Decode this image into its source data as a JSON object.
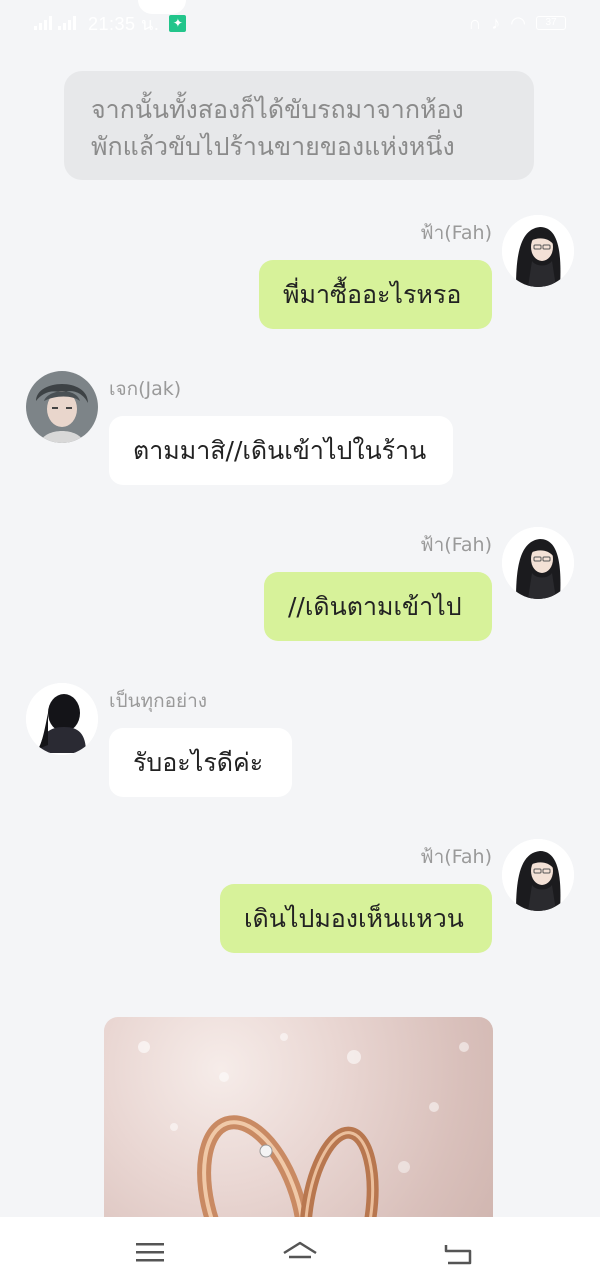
{
  "status_bar": {
    "time": "21:35 น.",
    "network_1": "4G",
    "network_2": "4G",
    "battery": "37",
    "icons": [
      "signal-icon",
      "signal-icon",
      "running-app-icon",
      "nfc-icon",
      "mute-icon",
      "wifi-icon",
      "battery-icon"
    ]
  },
  "narration": {
    "line1": "จากนั้นทั้งสองก็ได้ขับรถมาจากห้อง",
    "line2": "พักแล้วขับไปร้านขายของแห่งหนึ่ง"
  },
  "messages": [
    {
      "sender": "ฟ้า(Fah)",
      "text": "พี่มาซื้ออะไรหรอ",
      "side": "right"
    },
    {
      "sender": "เจก(Jak)",
      "text": "ตามมาสิ//เดินเข้าไปในร้าน",
      "side": "left"
    },
    {
      "sender": "ฟ้า(Fah)",
      "text": "//เดินตามเข้าไป",
      "side": "right"
    },
    {
      "sender": "เป็นทุกอย่าง",
      "text": "รับอะไรดีค่ะ",
      "side": "left"
    },
    {
      "sender": "ฟ้า(Fah)",
      "text": "เดินไปมองเห็นแหวน",
      "side": "right"
    }
  ],
  "image_message": {
    "icon": "rings-photo"
  },
  "nav_bar": {
    "icons": [
      "menu-icon",
      "home-icon",
      "back-icon"
    ]
  },
  "colors": {
    "background": "#f4f5f7",
    "bubble_right": "#d7f29a",
    "bubble_left": "#ffffff",
    "narration_bg": "#e7e8ea",
    "name_text": "#9a9a9a"
  }
}
